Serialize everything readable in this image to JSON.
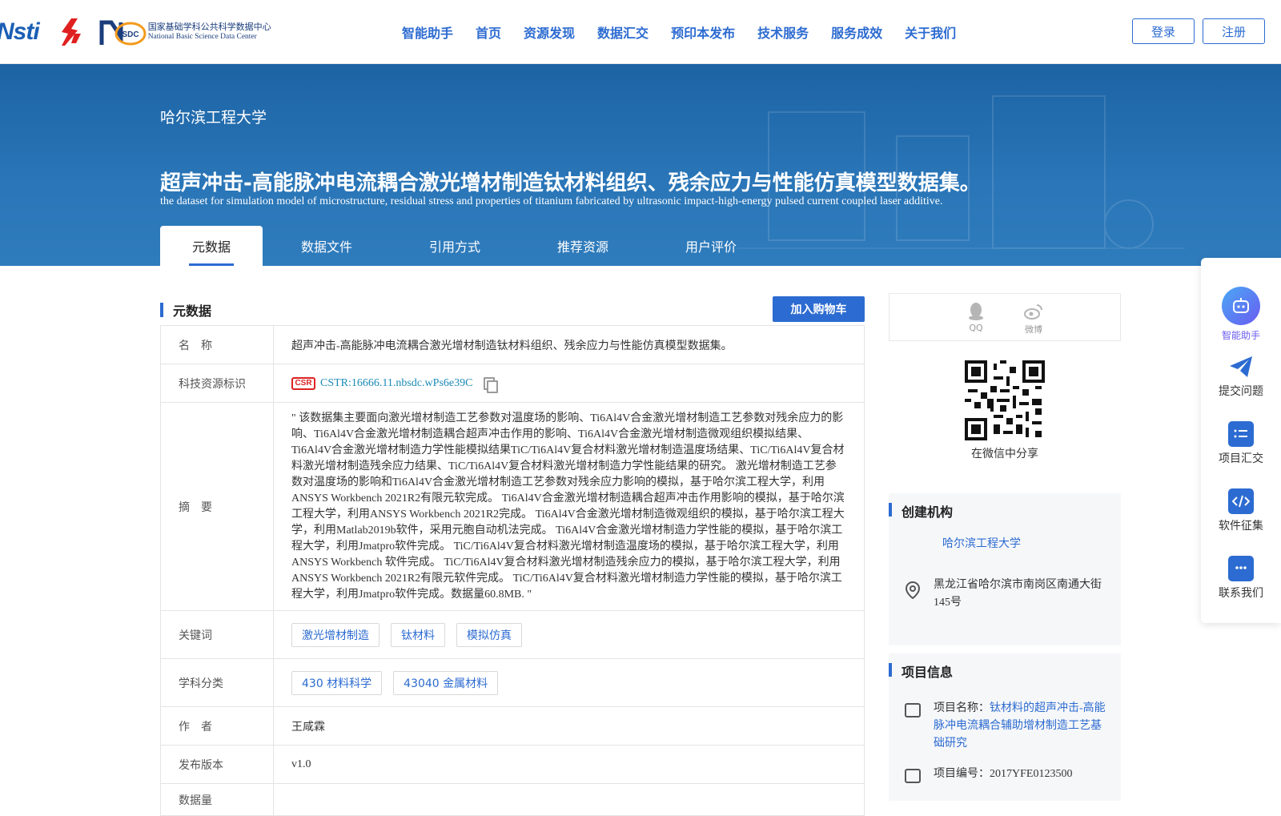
{
  "header": {
    "logo_nstl": "Nsti",
    "logo_nsdc_mark": "SDC",
    "logo_nsdc_cn": "国家基础学科公共科学数据中心",
    "logo_nsdc_en": "National Basic Science Data Center",
    "nav": [
      "智能助手",
      "首页",
      "资源发现",
      "数据汇交",
      "预印本发布",
      "技术服务",
      "服务成效",
      "关于我们"
    ],
    "login": "登录",
    "register": "注册"
  },
  "banner": {
    "institution": "哈尔滨工程大学",
    "title_cn": "超声冲击-高能脉冲电流耦合激光增材制造钛材料组织、残余应力与性能仿真模型数据集。",
    "title_en": "the dataset for simulation model of microstructure, residual stress and properties of titanium fabricated by ultrasonic impact-high-energy pulsed current coupled laser additive.",
    "tabs": [
      "元数据",
      "数据文件",
      "引用方式",
      "推荐资源",
      "用户评价"
    ],
    "active_tab": 0
  },
  "metadata": {
    "section_title": "元数据",
    "cart_button": "加入购物车",
    "rows": {
      "name_label": "名　称",
      "name_value": "超声冲击-高能脉冲电流耦合激光增材制造钛材料组织、残余应力与性能仿真模型数据集。",
      "cstr_label": "科技资源标识",
      "cstr_logo": "CSR",
      "cstr_value": "CSTR:16666.11.nbsdc.wPs6e39C",
      "abstract_label": "摘　要",
      "abstract_value": "\" 该数据集主要面向激光增材制造工艺参数对温度场的影响、Ti6Al4V合金激光增材制造工艺参数对残余应力的影响、Ti6Al4V合金激光增材制造耦合超声冲击作用的影响、Ti6Al4V合金激光增材制造微观组织模拟结果、Ti6Al4V合金激光增材制造力学性能模拟结果TiC/Ti6Al4V复合材料激光增材制造温度场结果、TiC/Ti6Al4V复合材料激光增材制造残余应力结果、TiC/Ti6Al4V复合材料激光增材制造力学性能结果的研究。 激光增材制造工艺参数对温度场的影响和Ti6Al4V合金激光增材制造工艺参数对残余应力影响的模拟，基于哈尔滨工程大学，利用ANSYS Workbench 2021R2有限元软完成。 Ti6Al4V合金激光增材制造耦合超声冲击作用影响的模拟，基于哈尔滨工程大学，利用ANSYS Workbench 2021R2完成。 Ti6Al4V合金激光增材制造微观组织的模拟，基于哈尔滨工程大学，利用Matlab2019b软件，采用元胞自动机法完成。 Ti6Al4V合金激光增材制造力学性能的模拟，基于哈尔滨工程大学，利用Jmatpro软件完成。 TiC/Ti6Al4V复合材料激光增材制造温度场的模拟，基于哈尔滨工程大学，利用ANSYS Workbench 软件完成。 TiC/Ti6Al4V复合材料激光增材制造残余应力的模拟，基于哈尔滨工程大学，利用ANSYS Workbench 2021R2有限元软件完成。 TiC/Ti6Al4V复合材料激光增材制造力学性能的模拟，基于哈尔滨工程大学，利用Jmatpro软件完成。数据量60.8MB. \"",
      "keywords_label": "关键词",
      "keywords": [
        "激光增材制造",
        "钛材料",
        "模拟仿真"
      ],
      "subject_label": "学科分类",
      "subjects": [
        "430 材料科学",
        "43040 金属材料"
      ],
      "author_label": "作　者",
      "author_value": "王咸霖",
      "version_label": "发布版本",
      "version_value": "v1.0",
      "next_label": "数据量"
    }
  },
  "share": {
    "qq": "QQ",
    "weibo": "微博",
    "wechat_label": "在微信中分享"
  },
  "creator": {
    "title": "创建机构",
    "org": "哈尔滨工程大学",
    "address": "黑龙江省哈尔滨市南岗区南通大街145号"
  },
  "project": {
    "title": "项目信息",
    "name_label": "项目名称：",
    "name_value": "钛材料的超声冲击-高能脉冲电流耦合辅助增材制造工艺基础研究",
    "code_label": "项目编号：",
    "code_value": "2017YFE0123500"
  },
  "floating": {
    "assistant": "智能助手",
    "submit": "提交问题",
    "project": "项目汇交",
    "software": "软件征集",
    "contact": "联系我们"
  },
  "colors": {
    "brand_blue": "#2c6bd1",
    "banner_blue": "#1c63a4",
    "cstr_red": "#dd2222",
    "assistant_purple": "#6a5cf0"
  }
}
